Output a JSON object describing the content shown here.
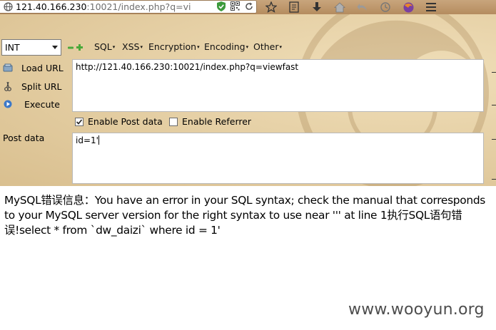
{
  "browser": {
    "url_host": "121.40.166.230",
    "url_rest": ":10021/index.php?q=vi"
  },
  "hackbar": {
    "type_select": "INT",
    "menus": [
      "SQL",
      "XSS",
      "Encryption",
      "Encoding",
      "Other"
    ],
    "load_url": "Load URL",
    "split_url": "Split URL",
    "execute": "Execute",
    "url_value": "http://121.40.166.230:10021/index.php?q=viewfast",
    "enable_post": "Enable Post data",
    "enable_post_checked": true,
    "enable_referrer": "Enable Referrer",
    "enable_referrer_checked": false,
    "post_label": "Post data",
    "post_value": "id=1'"
  },
  "page": {
    "error_text": "MySQL错误信息：You have an error in your SQL syntax; check the manual that corresponds to your MySQL server version for the right syntax to use near ''' at line 1执行SQL语句错误!select * from `dw_daizi` where id = 1'",
    "watermark": "www.wooyun.org"
  },
  "colors": {
    "parchment": "#e7d2a8",
    "toolbar": "#c8a57c",
    "shield": "#3c9a3c"
  }
}
